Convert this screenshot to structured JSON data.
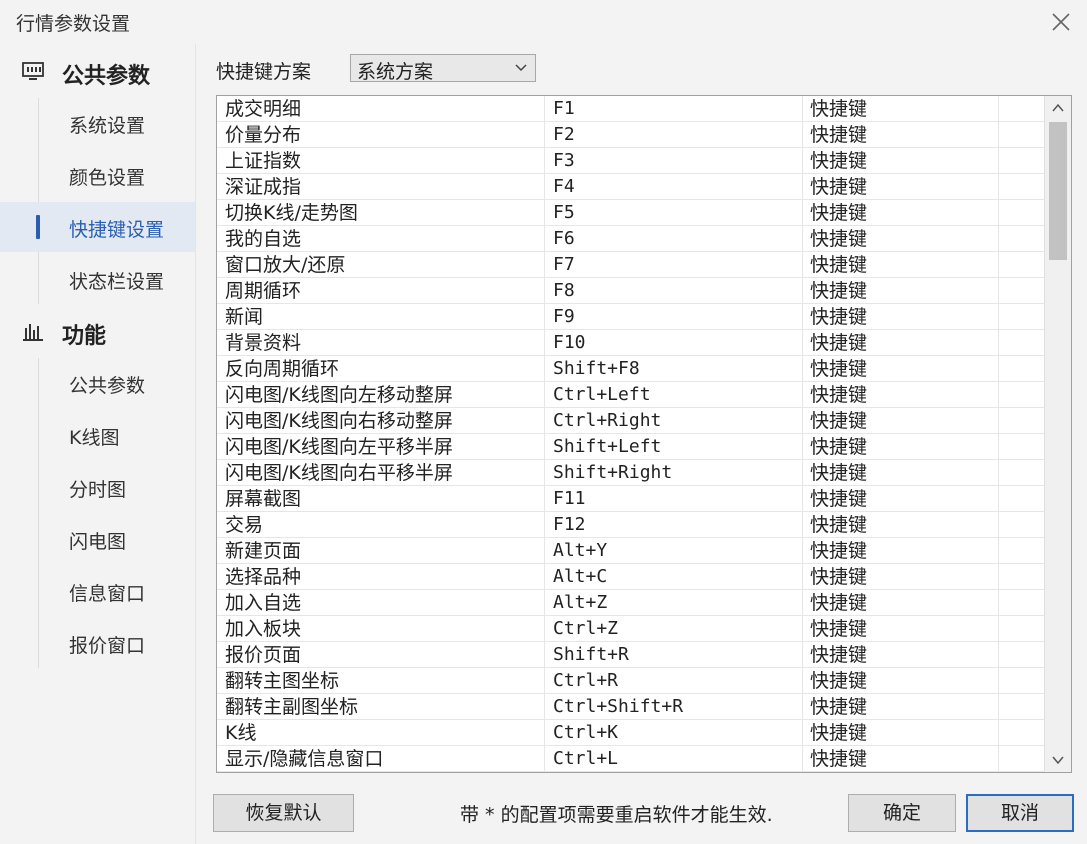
{
  "window": {
    "title": "行情参数设置",
    "close_icon": "close-icon"
  },
  "sidebar": {
    "groups": [
      {
        "label": "公共参数",
        "icon": "monitor-icon",
        "items": [
          {
            "label": "系统设置",
            "active": false
          },
          {
            "label": "颜色设置",
            "active": false
          },
          {
            "label": "快捷键设置",
            "active": true
          },
          {
            "label": "状态栏设置",
            "active": false
          }
        ]
      },
      {
        "label": "功能",
        "icon": "bar-chart-icon",
        "items": [
          {
            "label": "公共参数",
            "active": false
          },
          {
            "label": "K线图",
            "active": false
          },
          {
            "label": "分时图",
            "active": false
          },
          {
            "label": "闪电图",
            "active": false
          },
          {
            "label": "信息窗口",
            "active": false
          },
          {
            "label": "报价窗口",
            "active": false
          }
        ]
      }
    ]
  },
  "main": {
    "scheme_label": "快捷键方案",
    "scheme_value": "系统方案",
    "table": {
      "rows": [
        [
          "成交明细",
          "F1",
          "快捷键"
        ],
        [
          "价量分布",
          "F2",
          "快捷键"
        ],
        [
          "上证指数",
          "F3",
          "快捷键"
        ],
        [
          "深证成指",
          "F4",
          "快捷键"
        ],
        [
          "切换K线/走势图",
          "F5",
          "快捷键"
        ],
        [
          "我的自选",
          "F6",
          "快捷键"
        ],
        [
          "窗口放大/还原",
          "F7",
          "快捷键"
        ],
        [
          "周期循环",
          "F8",
          "快捷键"
        ],
        [
          "新闻",
          "F9",
          "快捷键"
        ],
        [
          "背景资料",
          "F10",
          "快捷键"
        ],
        [
          "反向周期循环",
          "Shift+F8",
          "快捷键"
        ],
        [
          "闪电图/K线图向左移动整屏",
          "Ctrl+Left",
          "快捷键"
        ],
        [
          "闪电图/K线图向右移动整屏",
          "Ctrl+Right",
          "快捷键"
        ],
        [
          "闪电图/K线图向左平移半屏",
          "Shift+Left",
          "快捷键"
        ],
        [
          "闪电图/K线图向右平移半屏",
          "Shift+Right",
          "快捷键"
        ],
        [
          "屏幕截图",
          "F11",
          "快捷键"
        ],
        [
          "交易",
          "F12",
          "快捷键"
        ],
        [
          "新建页面",
          "Alt+Y",
          "快捷键"
        ],
        [
          "选择品种",
          "Alt+C",
          "快捷键"
        ],
        [
          "加入自选",
          "Alt+Z",
          "快捷键"
        ],
        [
          "加入板块",
          "Ctrl+Z",
          "快捷键"
        ],
        [
          "报价页面",
          "Shift+R",
          "快捷键"
        ],
        [
          "翻转主图坐标",
          "Ctrl+R",
          "快捷键"
        ],
        [
          "翻转主副图坐标",
          "Ctrl+Shift+R",
          "快捷键"
        ],
        [
          "K线",
          "Ctrl+K",
          "快捷键"
        ],
        [
          "显示/隐藏信息窗口",
          "Ctrl+L",
          "快捷键"
        ]
      ]
    }
  },
  "footer": {
    "reset_label": "恢复默认",
    "note": "带 * 的配置项需要重启软件才能生效.",
    "ok_label": "确定",
    "cancel_label": "取消"
  },
  "colors": {
    "accent": "#2a5fb0",
    "active_bg": "#e3e9f3",
    "window_bg": "#f3f3f3"
  }
}
